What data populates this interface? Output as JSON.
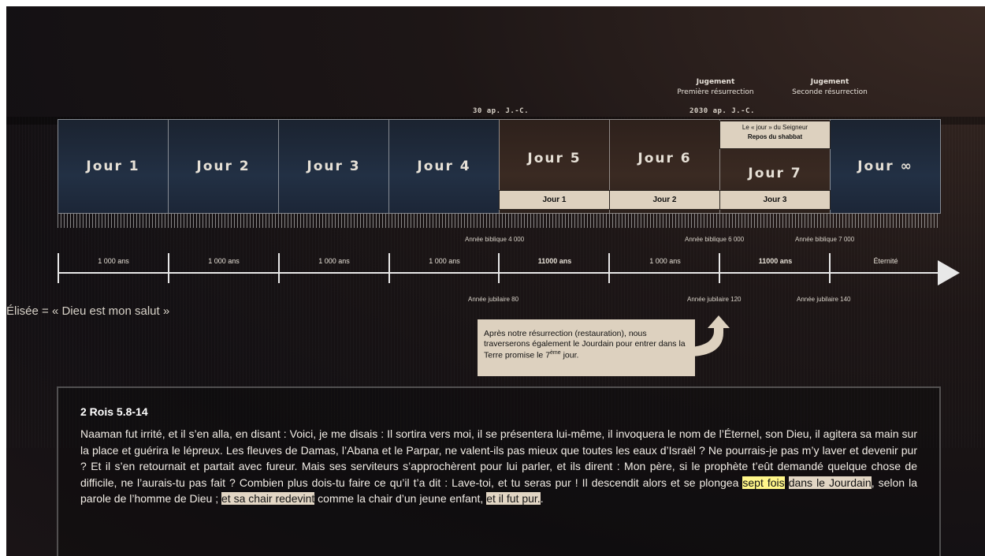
{
  "top_labels": {
    "jugement1_title": "Jugement",
    "jugement1_sub": "Première résurrection",
    "jugement2_title": "Jugement",
    "jugement2_sub": "Seconde résurrection"
  },
  "dates": {
    "d1": "30 ap. J.-C.",
    "d2": "2030 ap. J.-C."
  },
  "days": [
    {
      "label": "Jour 1"
    },
    {
      "label": "Jour 2"
    },
    {
      "label": "Jour 3"
    },
    {
      "label": "Jour 4"
    },
    {
      "label": "Jour 5"
    },
    {
      "label": "Jour 6"
    },
    {
      "label": "Jour 7"
    },
    {
      "label": "Jour ∞"
    }
  ],
  "sub_days": [
    "Jour 1",
    "Jour 2",
    "Jour 3"
  ],
  "lord_box": {
    "line1": "Le « jour » du Seigneur",
    "line2": "Repos du shabbat"
  },
  "segments": [
    "1 000 ans",
    "1 000 ans",
    "1 000 ans",
    "1 000 ans",
    "11000 ans",
    "1 000 ans",
    "11000 ans",
    "Éternité"
  ],
  "years_top": {
    "y1": "Année biblique 4 000",
    "y2": "Année biblique 6 000",
    "y3": "Année biblique 7 000"
  },
  "years_bottom": {
    "y1": "Année jubilaire 80",
    "y2": "Année jubilaire 120",
    "y3": "Année jubilaire 140"
  },
  "elisee": "Élisée = « Dieu est mon salut »",
  "note": {
    "text": "Après notre résurrection (restauration), nous traverserons également le Jourdain pour entrer dans la Terre promise le 7",
    "sup": "ème",
    "end": " jour."
  },
  "passage": {
    "ref": "2 Rois 5.8-14",
    "t1": "Naaman fut irrité, et il s’en alla, en disant : Voici, je me disais : Il sortira vers moi, il se présentera lui-même, il invoquera le nom de l’Éternel, son Dieu, il agitera sa main sur la place et guérira le lépreux. Les fleuves de Damas, l’Abana et le Parpar, ne valent-ils pas mieux que toutes les eaux d’Israël ? Ne pourrais-je pas m’y laver et devenir pur ? Et il s’en retournait et partait avec fureur. Mais ses serviteurs s’approchèrent pour lui parler, et ils dirent : Mon père, si le prophète t’eût demandé quelque chose de difficile, ne l’aurais-tu pas fait ? Combien plus dois-tu faire ce qu’il t’a dit : Lave-toi, et tu seras pur ! Il descendit alors et se plongea ",
    "h1": "sept fois",
    "t2": " ",
    "h2": "dans le Jourdain",
    "t3": ", selon la parole de l’homme de Dieu ; ",
    "h3": "et sa chair redevint",
    "t4": " comme la chair d’un jeune enfant, ",
    "h4": "et il fut pur.",
    "t5": "."
  },
  "colors": {
    "highlight_yellow": "#fff68a",
    "highlight_beige": "#e2d6c4",
    "box_beige": "#ddd1bf"
  }
}
